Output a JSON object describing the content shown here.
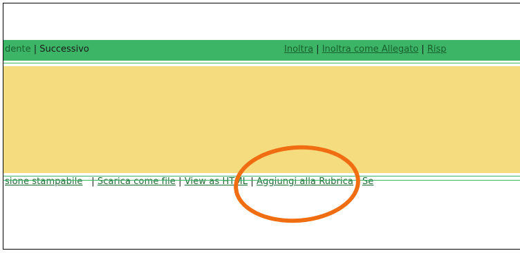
{
  "nav": {
    "left": {
      "prev_label": "dente",
      "separator": " | ",
      "next_label": "Successivo"
    },
    "right": {
      "forward_label": "Inoltra",
      "separator_1": " | ",
      "forward_attachment_label": "Inoltra come Allegato",
      "separator_2": " | ",
      "reply_label": "Risp"
    }
  },
  "actions": {
    "items": [
      {
        "label": "sione stampabile"
      },
      {
        "label": "Scarica come file"
      },
      {
        "label": "View as HTML"
      },
      {
        "label": "Aggiungi alla Rubrica"
      },
      {
        "label": "Se"
      }
    ],
    "separator": "|"
  },
  "colors": {
    "nav_bg": "#3cb566",
    "panel_bg": "#f5dd7f",
    "highlight": "#f06d12",
    "link": "#1f6b34"
  }
}
